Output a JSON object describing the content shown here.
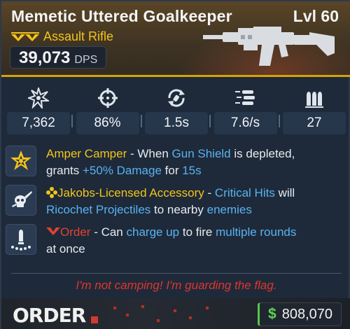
{
  "weapon": {
    "name": "Memetic Uttered Goalkeeper",
    "level": "Lvl 60",
    "type": "Assault Rifle",
    "dps": "39,073",
    "dps_label": "DPS",
    "rarity_color": "#f2c41a"
  },
  "stats": [
    {
      "icon": "damage-burst-icon",
      "value": "7,362"
    },
    {
      "icon": "crosshair-icon",
      "value": "86%"
    },
    {
      "icon": "reload-icon",
      "value": "1.5s"
    },
    {
      "icon": "fire-rate-icon",
      "value": "7.6/s"
    },
    {
      "icon": "magazine-icon",
      "value": "27"
    }
  ],
  "perks": [
    {
      "icon": "star-badge-icon",
      "segments": {
        "a": "Amper Camper",
        "b": " - When ",
        "c": "Gun Shield",
        "d": " is depleted,",
        "e": "grants ",
        "f": "+50% Damage",
        "g": " for ",
        "h": "15s"
      }
    },
    {
      "icon": "skull-icon",
      "segments": {
        "a": "Jakobs-Licensed Accessory",
        "b": " - ",
        "c": "Critical Hits",
        "d": " will",
        "e": "Ricochet Projectiles",
        "f": " to nearby ",
        "g": "enemies"
      }
    },
    {
      "icon": "order-firing-icon",
      "segments": {
        "a": "Order",
        "b": " - Can ",
        "c": "charge up",
        "d": " to fire ",
        "e": "multiple rounds",
        "f": "at once"
      }
    }
  ],
  "flavor_text": "I'm not camping! I'm guarding the flag.",
  "footer": {
    "manufacturer": "ORDER",
    "currency_symbol": "$",
    "price": "808,070"
  },
  "colors": {
    "gold": "#f2c41a",
    "blue": "#5ab2f2",
    "red": "#e3412f",
    "money_green": "#5fd354"
  }
}
